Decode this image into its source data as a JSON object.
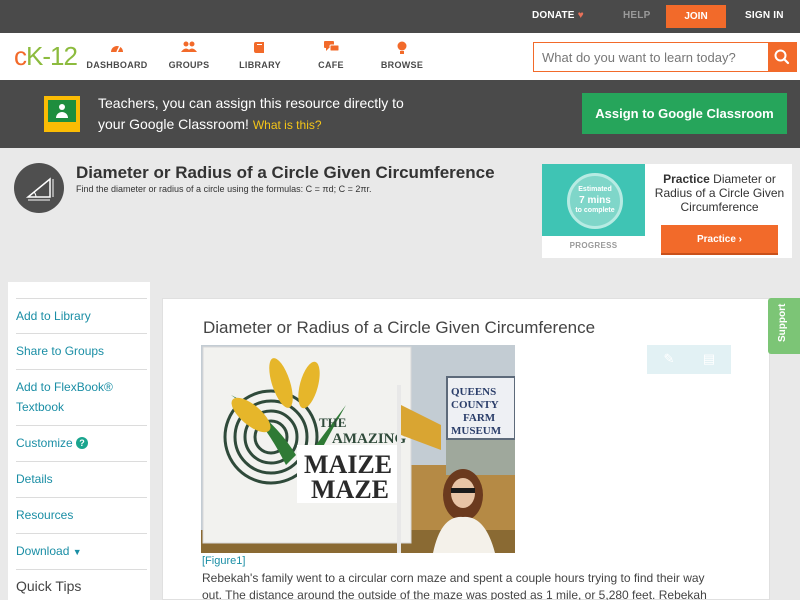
{
  "topbar": {
    "donate": "DONATE",
    "help": "HELP",
    "join": "JOIN",
    "signin": "SIGN IN"
  },
  "logo": {
    "c": "c",
    "k": "K-12"
  },
  "nav": {
    "items": [
      {
        "label": "DASHBOARD",
        "icon": "dashboard-icon"
      },
      {
        "label": "GROUPS",
        "icon": "groups-icon"
      },
      {
        "label": "LIBRARY",
        "icon": "library-icon"
      },
      {
        "label": "CAFE",
        "icon": "cafe-icon"
      },
      {
        "label": "BROWSE",
        "icon": "browse-icon"
      }
    ],
    "search_placeholder": "What do you want to learn today?"
  },
  "banner": {
    "line1": "Teachers, you can assign this resource directly to",
    "line2": "your Google Classroom!",
    "what_link": "What is this?",
    "assign_button": "Assign to Google Classroom"
  },
  "header": {
    "title": "Diameter or Radius of a Circle Given Circumference",
    "subtitle": "Find the diameter or radius of a circle using the formulas: C = πd; C = 2πr."
  },
  "practice_card": {
    "circle_l1": "Estimated",
    "circle_l2": "7 mins",
    "circle_l3": "to complete",
    "progress_label": "PROGRESS",
    "text_bold": "Practice",
    "text_rest": "Diameter or Radius of a Circle Given Circumference",
    "button": "Practice"
  },
  "sidebar": {
    "items": [
      "Add to Library",
      "Share to Groups",
      "Add to FlexBook®",
      "Textbook",
      "Customize",
      "Details",
      "Resources",
      "Download"
    ],
    "quick_tips": "Quick Tips"
  },
  "article": {
    "title": "Diameter or Radius of a Circle Given Circumference",
    "figure_caption": "[Figure1]",
    "figure_sign": {
      "the": "THE",
      "amazing": "AMAZING",
      "maize": "MAIZE",
      "maze": "MAZE",
      "museum_l1": "QUEENS",
      "museum_l2": "COUNTY",
      "museum_l3": "FARM",
      "museum_l4": "MUSEUM"
    },
    "body_line1": "Rebekah's family went to a circular corn maze and spent a couple hours trying to find their way",
    "body_line2": "out. The distance around the outside of the maze was posted as 1 mile, or 5,280 feet. Rebekah"
  },
  "support": "Support",
  "colors": {
    "accent": "#f26a2a",
    "brand_green": "#8cbb3e",
    "link": "#1a8ea5",
    "classroom_green": "#26a55b",
    "dark_bar": "#4a4a4a"
  }
}
